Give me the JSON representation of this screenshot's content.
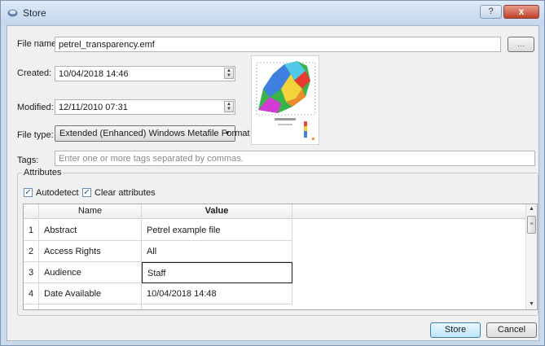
{
  "window": {
    "title": "Store",
    "help_label": "?",
    "close_label": "x"
  },
  "icons": {
    "app": "storage-icon",
    "help": "question-icon",
    "close": "close-icon"
  },
  "form": {
    "file_name": {
      "label": "File name:",
      "value": "petrel_transparency.emf",
      "browse_label": "..."
    },
    "created": {
      "label": "Created:",
      "value": "10/04/2018 14:46"
    },
    "modified": {
      "label": "Modified:",
      "value": "12/11/2010 07:31"
    },
    "file_type": {
      "label": "File type:",
      "value": "Extended (Enhanced) Windows Metafile Format"
    },
    "tags": {
      "label": "Tags:",
      "placeholder": "Enter one or more tags separated by commas."
    }
  },
  "attributes": {
    "title": "Attributes",
    "autodetect": {
      "label": "Autodetect",
      "checked": true
    },
    "clear": {
      "label": "Clear attributes",
      "checked": true
    },
    "columns": [
      "Name",
      "Value"
    ],
    "rows": [
      {
        "num": "1",
        "name": "Abstract",
        "value": "Petrel example file"
      },
      {
        "num": "2",
        "name": "Access Rights",
        "value": "All"
      },
      {
        "num": "3",
        "name": "Audience",
        "value": "Staff"
      },
      {
        "num": "4",
        "name": "Date Available",
        "value": "10/04/2018 14:48"
      }
    ]
  },
  "buttons": {
    "store": "Store",
    "cancel": "Cancel"
  },
  "colors": {
    "titlebar": "#c3d6ec",
    "client": "#f0f0f0",
    "accent": "#3c7fb1",
    "close": "#c2402a"
  }
}
